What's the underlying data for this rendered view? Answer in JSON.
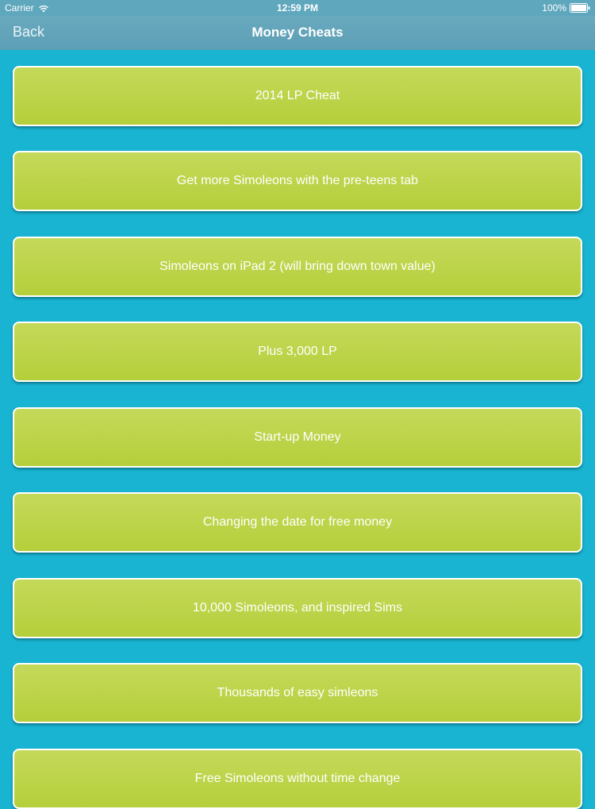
{
  "status_bar": {
    "carrier": "Carrier",
    "time": "12:59 PM",
    "battery": "100%"
  },
  "nav": {
    "back_label": "Back",
    "title": "Money Cheats"
  },
  "cheats": [
    {
      "label": "2014 LP Cheat"
    },
    {
      "label": "Get more Simoleons with the pre-teens tab"
    },
    {
      "label": "Simoleons on iPad 2 (will bring down town value)"
    },
    {
      "label": "Plus 3,000 LP"
    },
    {
      "label": "Start-up Money"
    },
    {
      "label": "Changing the date for free money"
    },
    {
      "label": "10,000 Simoleons, and inspired Sims"
    },
    {
      "label": "Thousands of easy simleons"
    },
    {
      "label": "Free Simoleons without time change"
    }
  ],
  "colors": {
    "background": "#18b4d2",
    "nav_bar": "#5fa7bd",
    "button_fill": "#b4cf3a",
    "button_border": "#ffffff"
  }
}
